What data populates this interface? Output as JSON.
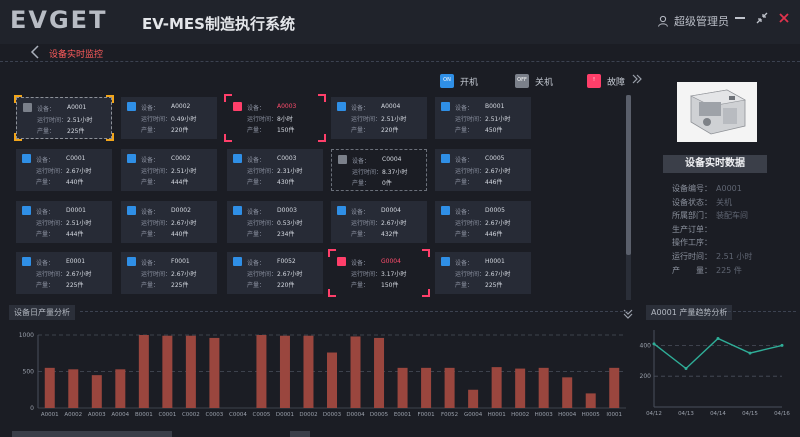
{
  "app": {
    "logo_text": "EVGET",
    "title": "EV-MES制造执行系统",
    "user": "超级管理员"
  },
  "breadcrumb": {
    "current": "设备实时监控"
  },
  "legend": [
    {
      "label": "开机",
      "icon": "on-icon",
      "color": "#2f8fe6",
      "badge": "ON"
    },
    {
      "label": "关机",
      "icon": "off-icon",
      "color": "#7b808a",
      "badge": "OFF"
    },
    {
      "label": "故障",
      "icon": "fault-icon",
      "color": "#ff3f6a",
      "badge": "!"
    }
  ],
  "card_labels": {
    "device": "设备：",
    "runtime": "运行时间：",
    "output": "产量："
  },
  "devices": [
    {
      "id": "A0001",
      "runtime": "2.51小时",
      "output": "225件",
      "status": "off",
      "selected": true
    },
    {
      "id": "A0002",
      "runtime": "0.49小时",
      "output": "220件",
      "status": "on"
    },
    {
      "id": "A0003",
      "runtime": "8小时",
      "output": "150件",
      "status": "fault"
    },
    {
      "id": "A0004",
      "runtime": "2.51小时",
      "output": "220件",
      "status": "on"
    },
    {
      "id": "B0001",
      "runtime": "2.51小时",
      "output": "450件",
      "status": "on"
    },
    {
      "id": "C0001",
      "runtime": "2.67小时",
      "output": "440件",
      "status": "on"
    },
    {
      "id": "C0002",
      "runtime": "2.51小时",
      "output": "444件",
      "status": "on"
    },
    {
      "id": "C0003",
      "runtime": "2.31小时",
      "output": "430件",
      "status": "on"
    },
    {
      "id": "C0004",
      "runtime": "8.37小时",
      "output": "0件",
      "status": "off"
    },
    {
      "id": "C0005",
      "runtime": "2.67小时",
      "output": "446件",
      "status": "on"
    },
    {
      "id": "D0001",
      "runtime": "2.51小时",
      "output": "444件",
      "status": "on"
    },
    {
      "id": "D0002",
      "runtime": "2.67小时",
      "output": "440件",
      "status": "on"
    },
    {
      "id": "D0003",
      "runtime": "0.53小时",
      "output": "234件",
      "status": "on"
    },
    {
      "id": "D0004",
      "runtime": "2.67小时",
      "output": "432件",
      "status": "on"
    },
    {
      "id": "D0005",
      "runtime": "2.67小时",
      "output": "446件",
      "status": "on"
    },
    {
      "id": "E0001",
      "runtime": "2.67小时",
      "output": "225件",
      "status": "on"
    },
    {
      "id": "F0001",
      "runtime": "2.67小时",
      "output": "225件",
      "status": "on"
    },
    {
      "id": "F0052",
      "runtime": "2.67小时",
      "output": "220件",
      "status": "on"
    },
    {
      "id": "G0004",
      "runtime": "3.17小时",
      "output": "150件",
      "status": "fault"
    },
    {
      "id": "H0001",
      "runtime": "2.67小时",
      "output": "225件",
      "status": "on"
    }
  ],
  "detail": {
    "title": "设备实时数据",
    "rows": [
      {
        "label": "设备编号：",
        "value": "A0001"
      },
      {
        "label": "设备状态：",
        "value": "关机"
      },
      {
        "label": "所属部门：",
        "value": "装配车间"
      },
      {
        "label": "生产订单：",
        "value": ""
      },
      {
        "label": "操作工序：",
        "value": ""
      },
      {
        "label": "运行时间：",
        "value": "2.51 小时"
      },
      {
        "label": "产　　量：",
        "value": "225 件"
      }
    ]
  },
  "sections": {
    "output_title": "设备日产量分析",
    "trend_title": "A0001 产量趋势分析"
  },
  "chart_data": [
    {
      "type": "bar",
      "title": "设备日产量分析",
      "categories": [
        "A0001",
        "A0002",
        "A0003",
        "A0004",
        "B0001",
        "C0001",
        "C0002",
        "C0003",
        "C0004",
        "C0005",
        "D0001",
        "D0002",
        "D0003",
        "D0004",
        "D0005",
        "E0001",
        "F0001",
        "F0052",
        "G0004",
        "H0001",
        "H0002",
        "H0003",
        "H0004",
        "H0005",
        "I0001"
      ],
      "values": [
        550,
        530,
        450,
        530,
        1000,
        990,
        990,
        960,
        0,
        1000,
        990,
        990,
        760,
        980,
        960,
        550,
        550,
        550,
        250,
        560,
        540,
        550,
        420,
        200,
        550
      ],
      "ylim": [
        0,
        1000
      ],
      "yticks": [
        0,
        500,
        1000
      ],
      "color": "#9a463e",
      "grid": true
    },
    {
      "type": "line",
      "title": "A0001 产量趋势分析",
      "categories": [
        "04/12",
        "04/13",
        "04/14",
        "04/15",
        "04/16"
      ],
      "values": [
        410,
        250,
        445,
        350,
        400
      ],
      "ylim": [
        0,
        500
      ],
      "yticks": [
        200,
        400
      ],
      "color": "#2fae98",
      "grid": true
    }
  ]
}
